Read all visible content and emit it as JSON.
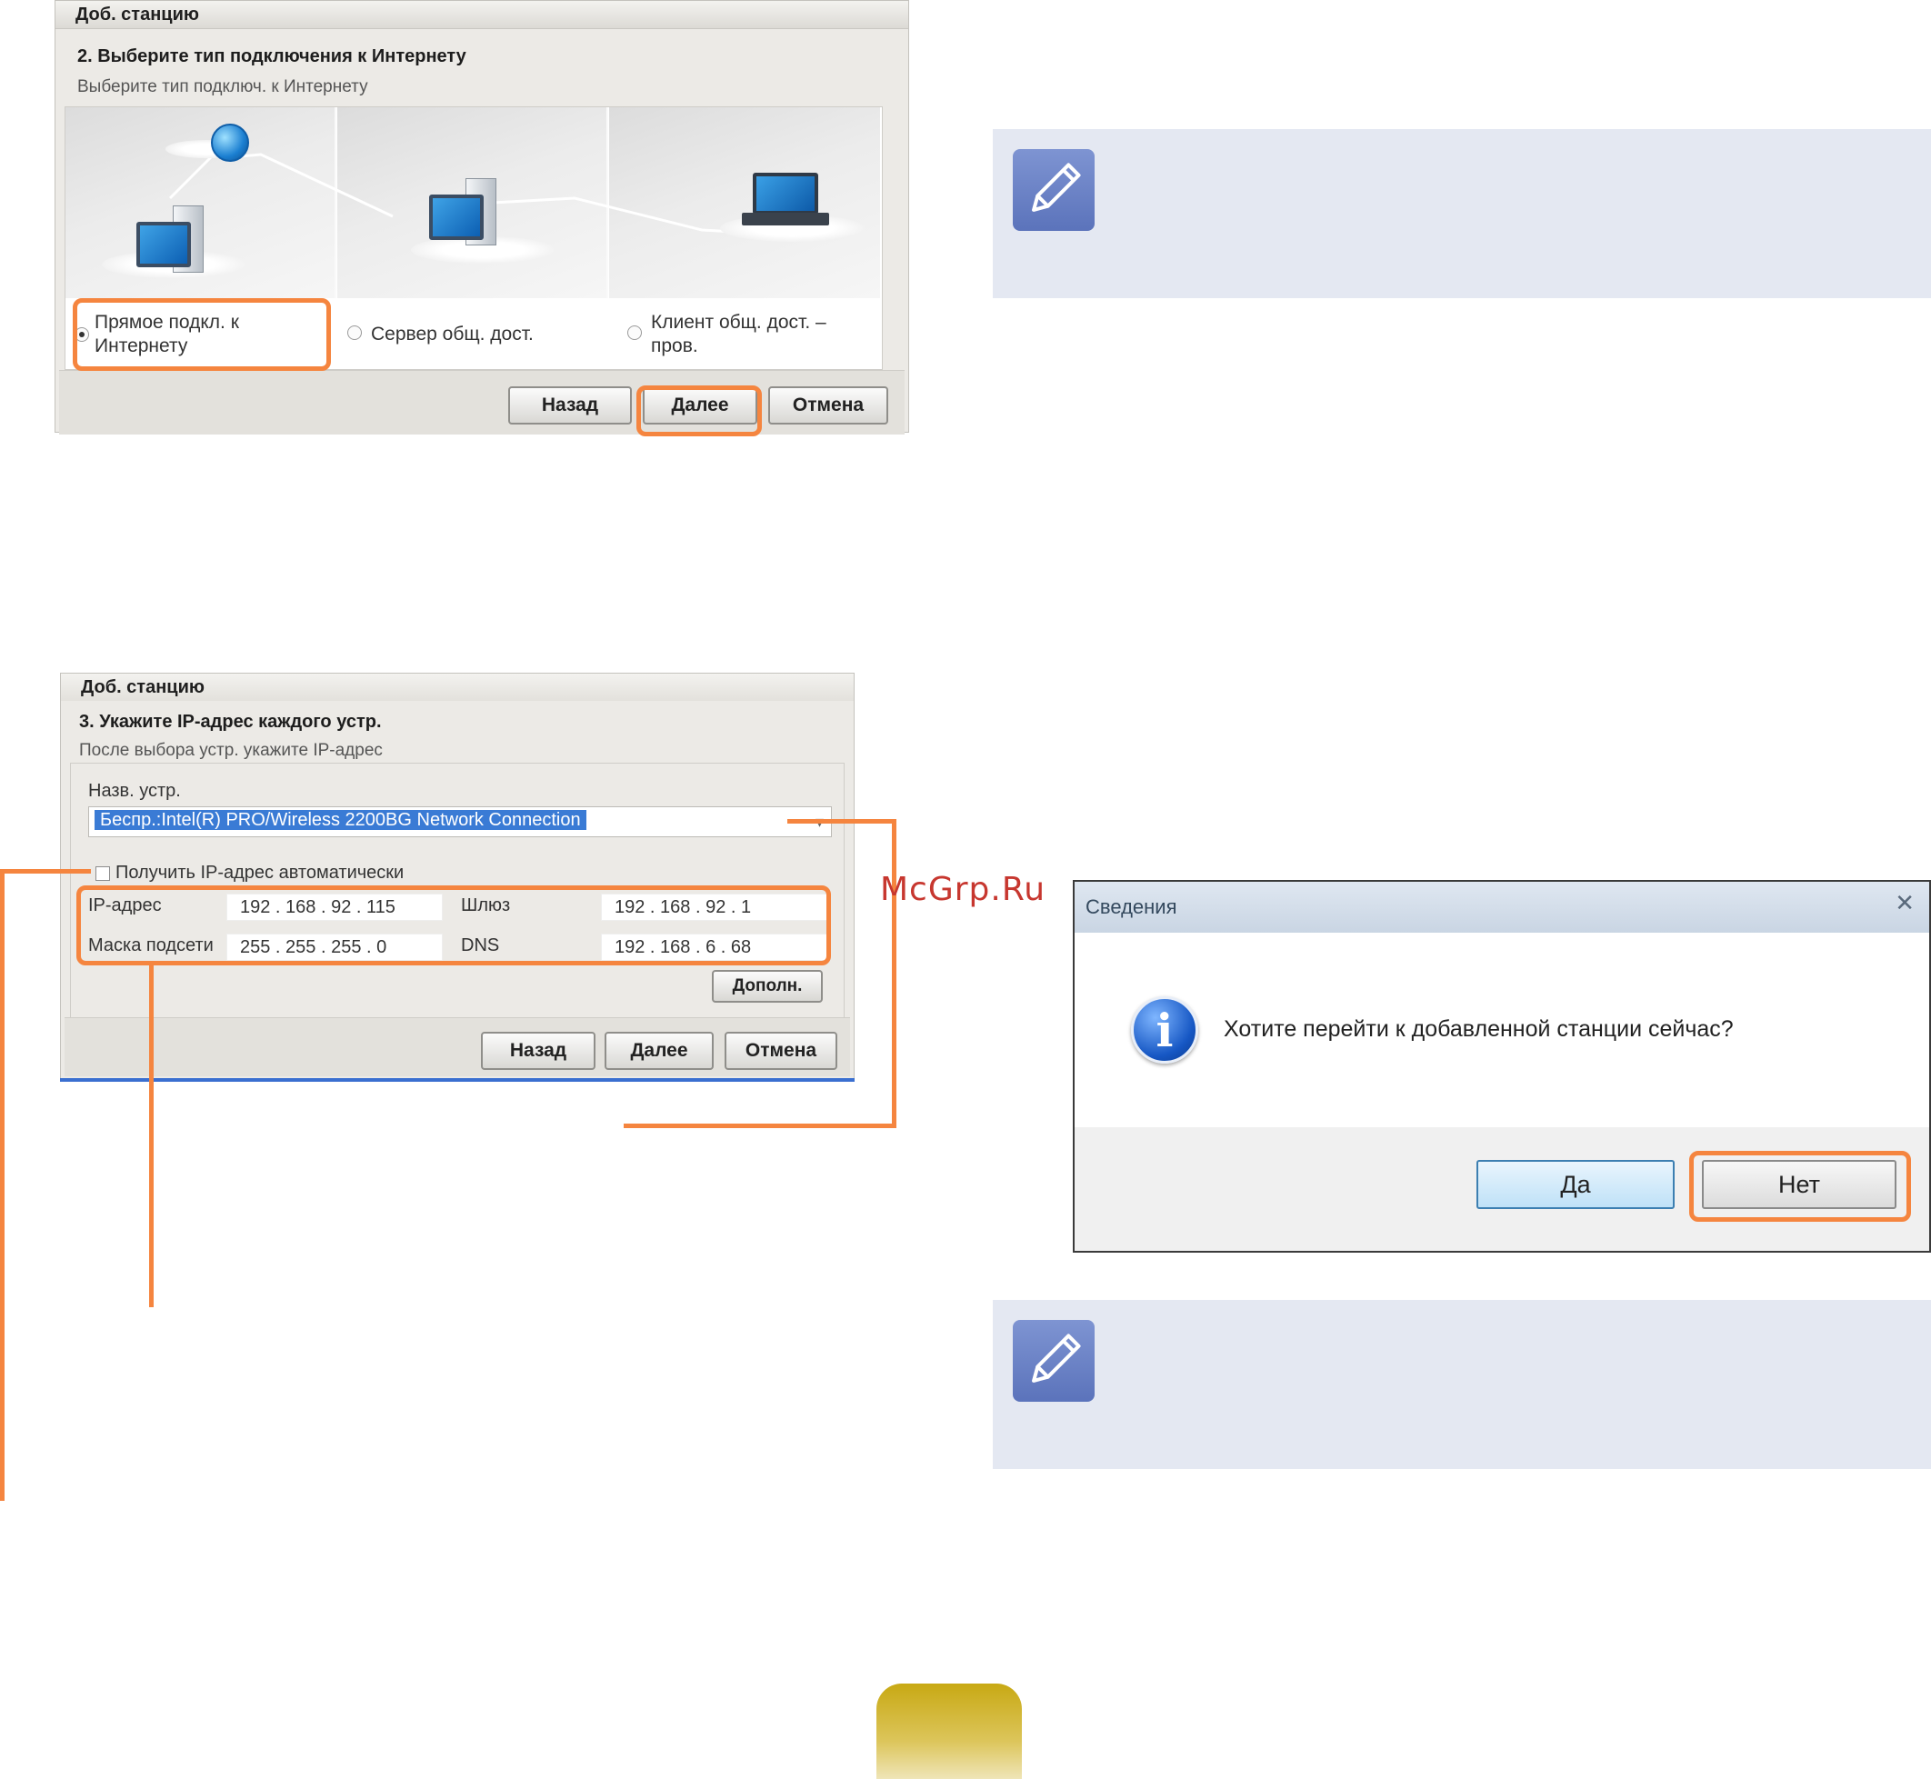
{
  "dialog_connection": {
    "title": "Доб. станцию",
    "step": "2. Выберите тип подключения к Интернету",
    "subtitle": "Выберите тип подключ. к Интернету",
    "options": [
      {
        "label": "Прямое подкл. к Интернету",
        "selected": true
      },
      {
        "label": "Сервер общ. дост.",
        "selected": false
      },
      {
        "label": "Клиент общ. дост. – пров.",
        "selected": false
      }
    ],
    "buttons": {
      "back": "Назад",
      "next": "Далее",
      "cancel": "Отмена"
    }
  },
  "dialog_ip": {
    "title": "Доб. станцию",
    "step": "3. Укажите IP-адрес каждого устр.",
    "subtitle": "После выбора устр. укажите IP-адрес",
    "device_label": "Назв. устр.",
    "device_value": "Беспр.:Intel(R) PRO/Wireless 2200BG Network Connection",
    "auto_ip_label": "Получить IP-адрес автоматически",
    "auto_ip_checked": false,
    "ip_label": "IP-адрес",
    "ip_value": "192 . 168 .  92  . 115",
    "gateway_label": "Шлюз",
    "gateway_value": "192 . 168 .  92  .  1",
    "mask_label": "Маска подсети",
    "mask_value": "255 . 255 . 255 .  0",
    "dns_label": "DNS",
    "dns_value": "192 . 168 .  6  .  68",
    "buttons": {
      "advanced": "Дополн.",
      "back": "Назад",
      "next": "Далее",
      "cancel": "Отмена"
    }
  },
  "info_dialog": {
    "title": "Сведения",
    "close_glyph": "✕",
    "message": "Хотите перейти к добавленной станции сейчас?",
    "buttons": {
      "yes": "Да",
      "no": "Нет"
    }
  },
  "watermark": "McGrp.Ru",
  "colors": {
    "highlight": "#f5853f",
    "note_bg": "#e4e8f2",
    "note_icon": "#6a82c8",
    "page_tab": "#c8a914"
  },
  "icons": [
    "pencil-note-icon",
    "info-icon",
    "globe-icon",
    "computer-icon",
    "laptop-icon"
  ]
}
